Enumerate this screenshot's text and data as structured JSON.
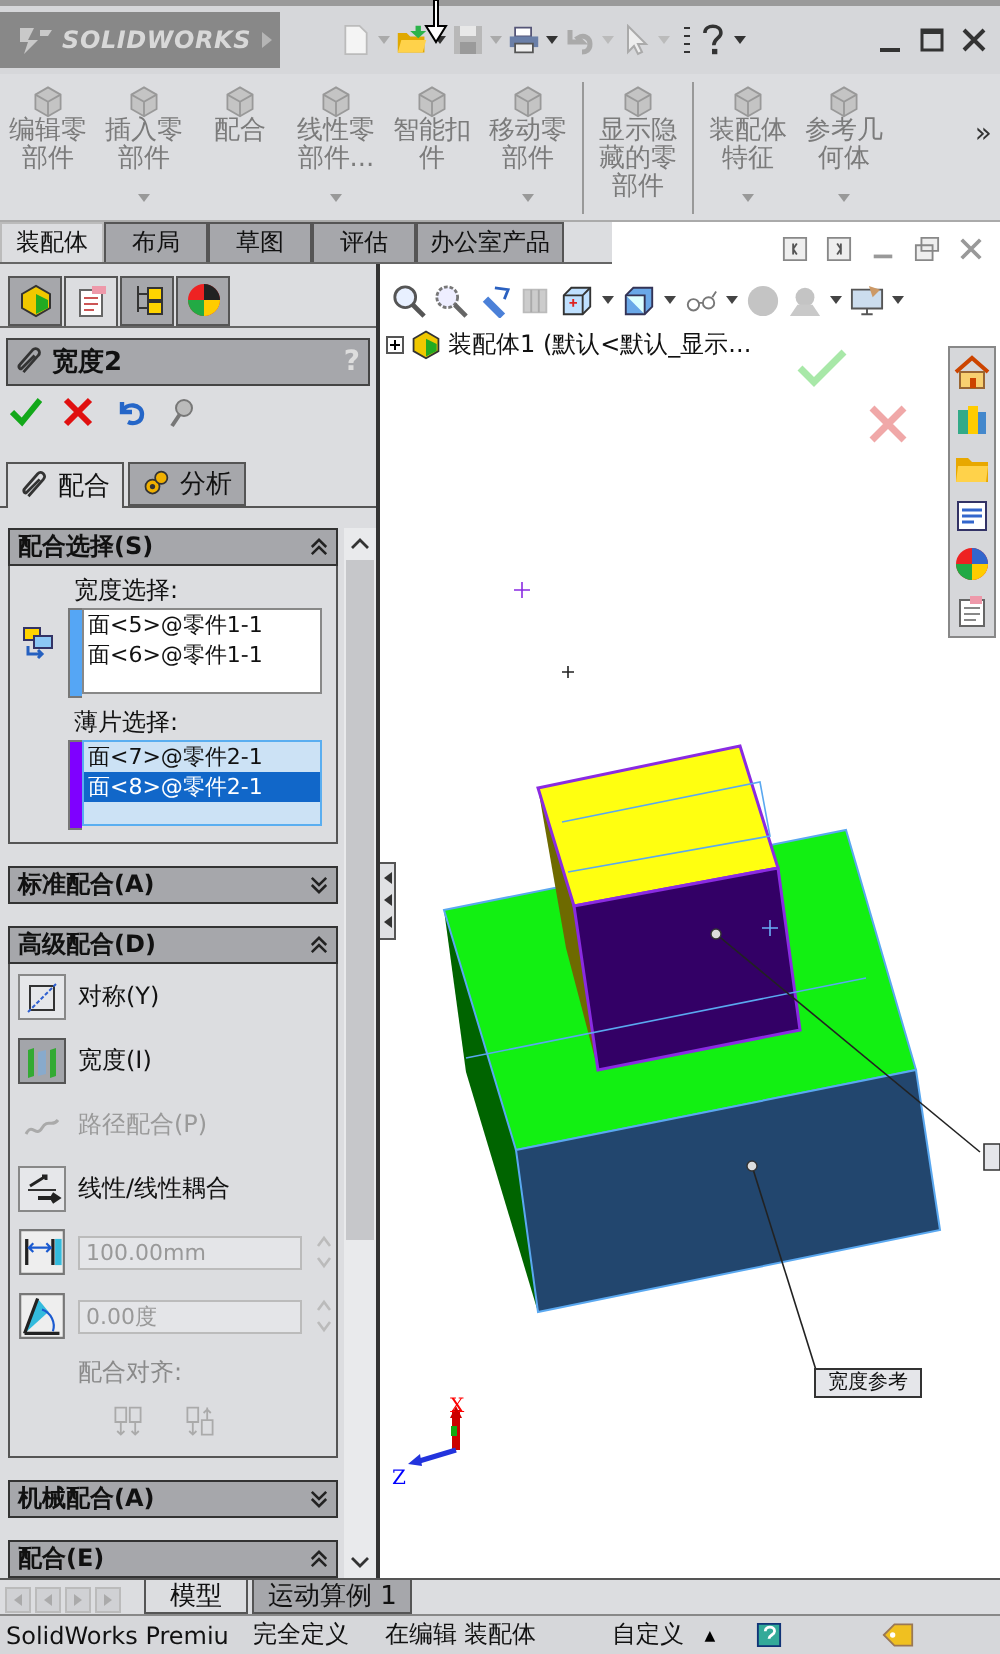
{
  "app": {
    "logo": "SOLIDWORKS"
  },
  "ribbon": {
    "groups": [
      [
        {
          "label": "编辑零部件",
          "disabled": true,
          "dropdown": false
        },
        {
          "label": "插入零部件",
          "disabled": true,
          "dropdown": true
        },
        {
          "label": "配合",
          "disabled": true,
          "dropdown": false
        },
        {
          "label": "线性零部件...",
          "disabled": true,
          "dropdown": true
        },
        {
          "label": "智能扣件",
          "disabled": true,
          "dropdown": false
        },
        {
          "label": "移动零部件",
          "disabled": true,
          "dropdown": true
        }
      ],
      [
        {
          "label": "显示隐藏的零部件",
          "disabled": true,
          "dropdown": false
        }
      ],
      [
        {
          "label": "装配体特征",
          "disabled": true,
          "dropdown": true
        },
        {
          "label": "参考几何体",
          "disabled": true,
          "dropdown": true
        }
      ]
    ],
    "more": "»"
  },
  "tabs": [
    {
      "label": "装配体",
      "selected": true
    },
    {
      "label": "布局",
      "selected": false
    },
    {
      "label": "草图",
      "selected": false
    },
    {
      "label": "评估",
      "selected": false
    },
    {
      "label": "办公室产品",
      "selected": false
    }
  ],
  "property_manager": {
    "manager_tabs": [
      {
        "selected": false
      },
      {
        "selected": true
      },
      {
        "selected": false
      },
      {
        "selected": false
      }
    ],
    "title": "宽度2",
    "help": "?",
    "subtabs": [
      {
        "label": "配合",
        "selected": true
      },
      {
        "label": "分析",
        "selected": false
      }
    ],
    "sections": [
      {
        "title": "配合选择(S)",
        "expanded": true,
        "kind": "selection"
      },
      {
        "title": "标准配合(A)",
        "expanded": false
      },
      {
        "title": "高级配合(D)",
        "expanded": true,
        "kind": "advanced"
      },
      {
        "title": "机械配合(A)",
        "expanded": false
      },
      {
        "title": "配合(E)",
        "expanded": true
      }
    ],
    "selection": {
      "lists": [
        {
          "label": "宽度选择:",
          "color": "#55a6f5",
          "active": false,
          "items": [
            {
              "text": "面<5>@零件1-1",
              "selected": false
            },
            {
              "text": "面<6>@零件1-1",
              "selected": false
            }
          ]
        },
        {
          "label": "薄片选择:",
          "color": "#7f00ff",
          "active": true,
          "items": [
            {
              "text": "面<7>@零件2-1",
              "selected": false
            },
            {
              "text": "面<8>@零件2-1",
              "selected": true
            }
          ]
        }
      ]
    },
    "advanced": {
      "options": [
        {
          "label": "对称(Y)",
          "selected": false,
          "disabled": false
        },
        {
          "label": "宽度(I)",
          "selected": true,
          "disabled": false
        },
        {
          "label": "路径配合(P)",
          "selected": false,
          "disabled": true
        },
        {
          "label": "线性/线性耦合",
          "selected": false,
          "disabled": false
        }
      ],
      "fields": [
        {
          "value": "100.00mm",
          "disabled": true
        },
        {
          "value": "0.00度",
          "disabled": true
        }
      ],
      "alignment": {
        "label": "配合对齐:",
        "disabled": true
      }
    }
  },
  "viewport": {
    "tree": {
      "root": "装配体1 (默认<默认_显示...",
      "expanded": false
    },
    "callouts": [
      {
        "text": "宽度参考"
      }
    ],
    "axes": [
      {
        "label": "X",
        "color": "#ff0000"
      },
      {
        "label": "Z",
        "color": "#0000ff"
      }
    ]
  },
  "bottom_tabs": [
    {
      "label": "模型",
      "selected": true
    },
    {
      "label": "运动算例 1",
      "selected": false
    }
  ],
  "status_bar": {
    "items": [
      "SolidWorks Premiu",
      "完全定义",
      "在编辑 装配体",
      "自定义"
    ],
    "caret": "▲"
  }
}
